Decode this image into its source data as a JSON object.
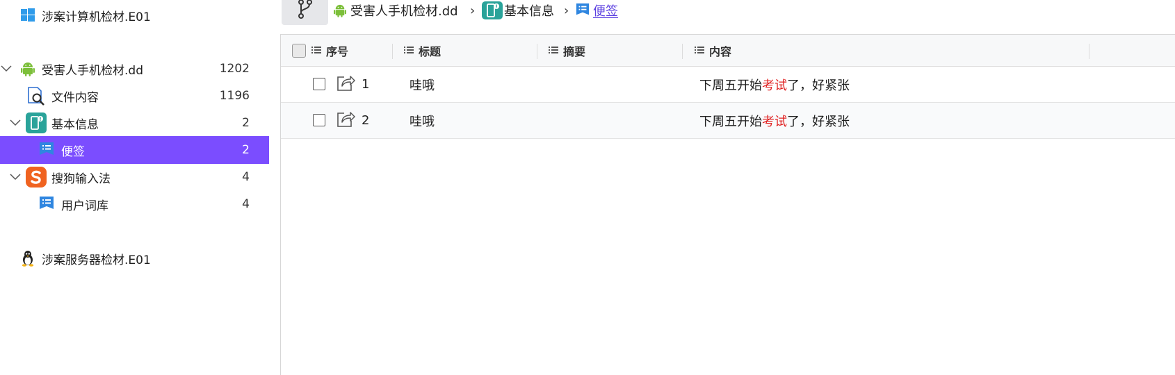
{
  "sidebar": {
    "items": [
      {
        "label": "涉案计算机检材.E01",
        "count": "",
        "icon": "windows-icon"
      },
      {
        "label": "受害人手机检材.dd",
        "count": "1202",
        "icon": "android-icon"
      },
      {
        "label": "文件内容",
        "count": "1196",
        "icon": "file-search-icon"
      },
      {
        "label": "基本信息",
        "count": "2",
        "icon": "phone-info-icon"
      },
      {
        "label": "便签",
        "count": "2",
        "icon": "note-icon"
      },
      {
        "label": "搜狗输入法",
        "count": "4",
        "icon": "sogou-icon"
      },
      {
        "label": "用户词库",
        "count": "4",
        "icon": "note-icon"
      },
      {
        "label": "涉案服务器检材.E01",
        "count": "",
        "icon": "linux-icon"
      }
    ]
  },
  "breadcrumb": {
    "items": [
      {
        "label": "受害人手机检材.dd",
        "icon": "android-icon"
      },
      {
        "label": "基本信息",
        "icon": "phone-info-icon"
      },
      {
        "label": "便签",
        "icon": "note-icon"
      }
    ],
    "separator": "›"
  },
  "table": {
    "columns": [
      "序号",
      "标题",
      "摘要",
      "内容"
    ],
    "rows": [
      {
        "index": "1",
        "title": "哇哦",
        "summary": "",
        "content_before": "下周五开始",
        "content_highlight": "考试",
        "content_after": "了，好紧张"
      },
      {
        "index": "2",
        "title": "哇哦",
        "summary": "",
        "content_before": "下周五开始",
        "content_highlight": "考试",
        "content_after": "了，好紧张"
      }
    ]
  },
  "colors": {
    "selected_bg": "#7b4dff",
    "highlight_text": "#e02020",
    "link_active": "#5b3fe0"
  }
}
